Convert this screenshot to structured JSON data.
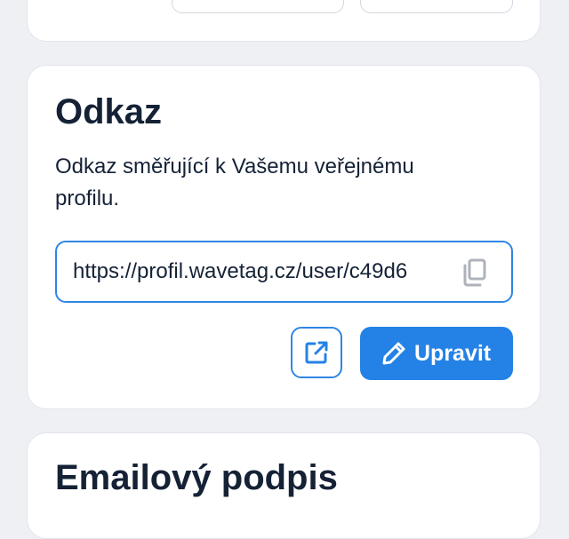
{
  "colors": {
    "accent": "#2482e6",
    "text": "#152236",
    "background": "#eef0f4",
    "card": "#ffffff"
  },
  "link_card": {
    "title": "Odkaz",
    "description": "Odkaz směřující k Vašemu veřejnému profilu.",
    "url_value": "https://profil.wavetag.cz/user/c49d6",
    "copy_icon": "copy-icon",
    "open_icon": "external-link-icon",
    "edit_icon": "pencil-icon",
    "edit_label": "Upravit"
  },
  "email_card": {
    "title": "Emailový podpis"
  }
}
